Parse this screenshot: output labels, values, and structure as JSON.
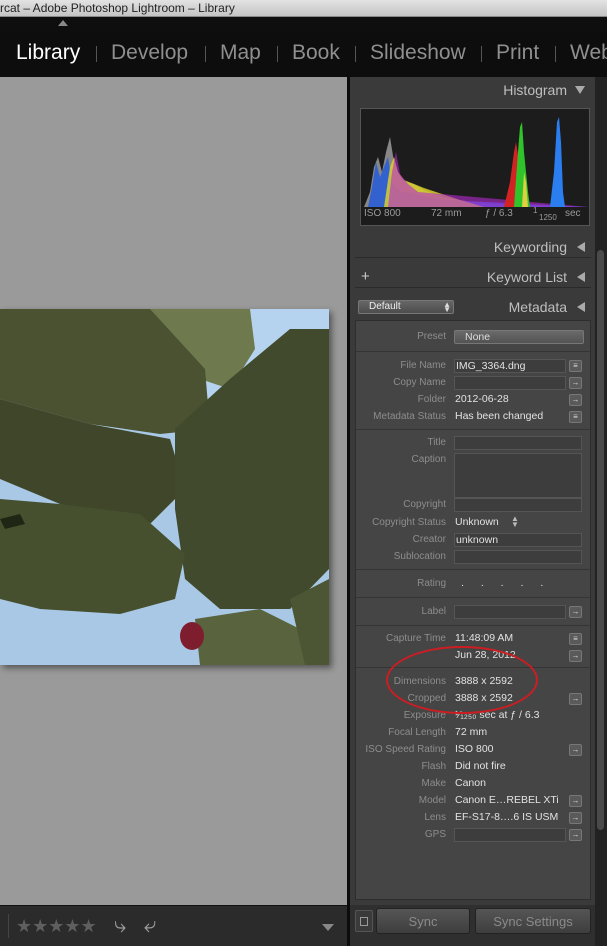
{
  "window": {
    "title": "rcat – Adobe Photoshop Lightroom – Library"
  },
  "modules": [
    {
      "label": "Library",
      "active": true
    },
    {
      "label": "Develop"
    },
    {
      "label": "Map"
    },
    {
      "label": "Book"
    },
    {
      "label": "Slideshow"
    },
    {
      "label": "Print"
    },
    {
      "label": "Web"
    }
  ],
  "histogram": {
    "title": "Histogram",
    "iso": "ISO 800",
    "focal": "72 mm",
    "aperture": "ƒ / 6.3",
    "shutter_num": "1",
    "shutter_den": "1250",
    "shutter_unit": "sec"
  },
  "keywording": {
    "title": "Keywording"
  },
  "keyword_list": {
    "title": "Keyword List",
    "add": "+"
  },
  "metadata": {
    "title": "Metadata",
    "preset_select": "Default",
    "preset_label": "Preset",
    "preset_value": "None",
    "file_name_label": "File Name",
    "file_name": "IMG_3364.dng",
    "copy_name_label": "Copy Name",
    "folder_label": "Folder",
    "folder": "2012-06-28",
    "status_label": "Metadata Status",
    "status": "Has been changed",
    "title_label": "Title",
    "caption_label": "Caption",
    "copyright_label": "Copyright",
    "copyright_status_label": "Copyright Status",
    "copyright_status": "Unknown",
    "creator_label": "Creator",
    "creator": "unknown",
    "sublocation_label": "Sublocation",
    "rating_label": "Rating",
    "rating": ". . . . .",
    "label_label": "Label",
    "capture_time_label": "Capture Time",
    "capture_time": "11:48:09 AM",
    "capture_date": "Jun 28, 2012",
    "dimensions_label": "Dimensions",
    "dimensions": "3888 x 2592",
    "cropped_label": "Cropped",
    "cropped": "3888 x 2592",
    "exposure_label": "Exposure",
    "exposure": "¹⁄₁₂₅₀ sec at ƒ / 6.3",
    "focal_label": "Focal Length",
    "focal": "72 mm",
    "iso_label": "ISO Speed Rating",
    "iso": "ISO 800",
    "flash_label": "Flash",
    "flash": "Did not fire",
    "make_label": "Make",
    "make": "Canon",
    "model_label": "Model",
    "model": "Canon E…REBEL XTi",
    "lens_label": "Lens",
    "lens": "EF-S17-8….6 IS USM",
    "gps_label": "GPS"
  },
  "bottom": {
    "stars": "★★★★★",
    "rotate_left": "⤷",
    "rotate_right": "⤶",
    "sync": "Sync",
    "sync_settings": "Sync Settings"
  },
  "colors": {
    "annotation": "#cc1e22",
    "module_active": "#ffffff",
    "module_inactive": "#8f8f8f"
  }
}
